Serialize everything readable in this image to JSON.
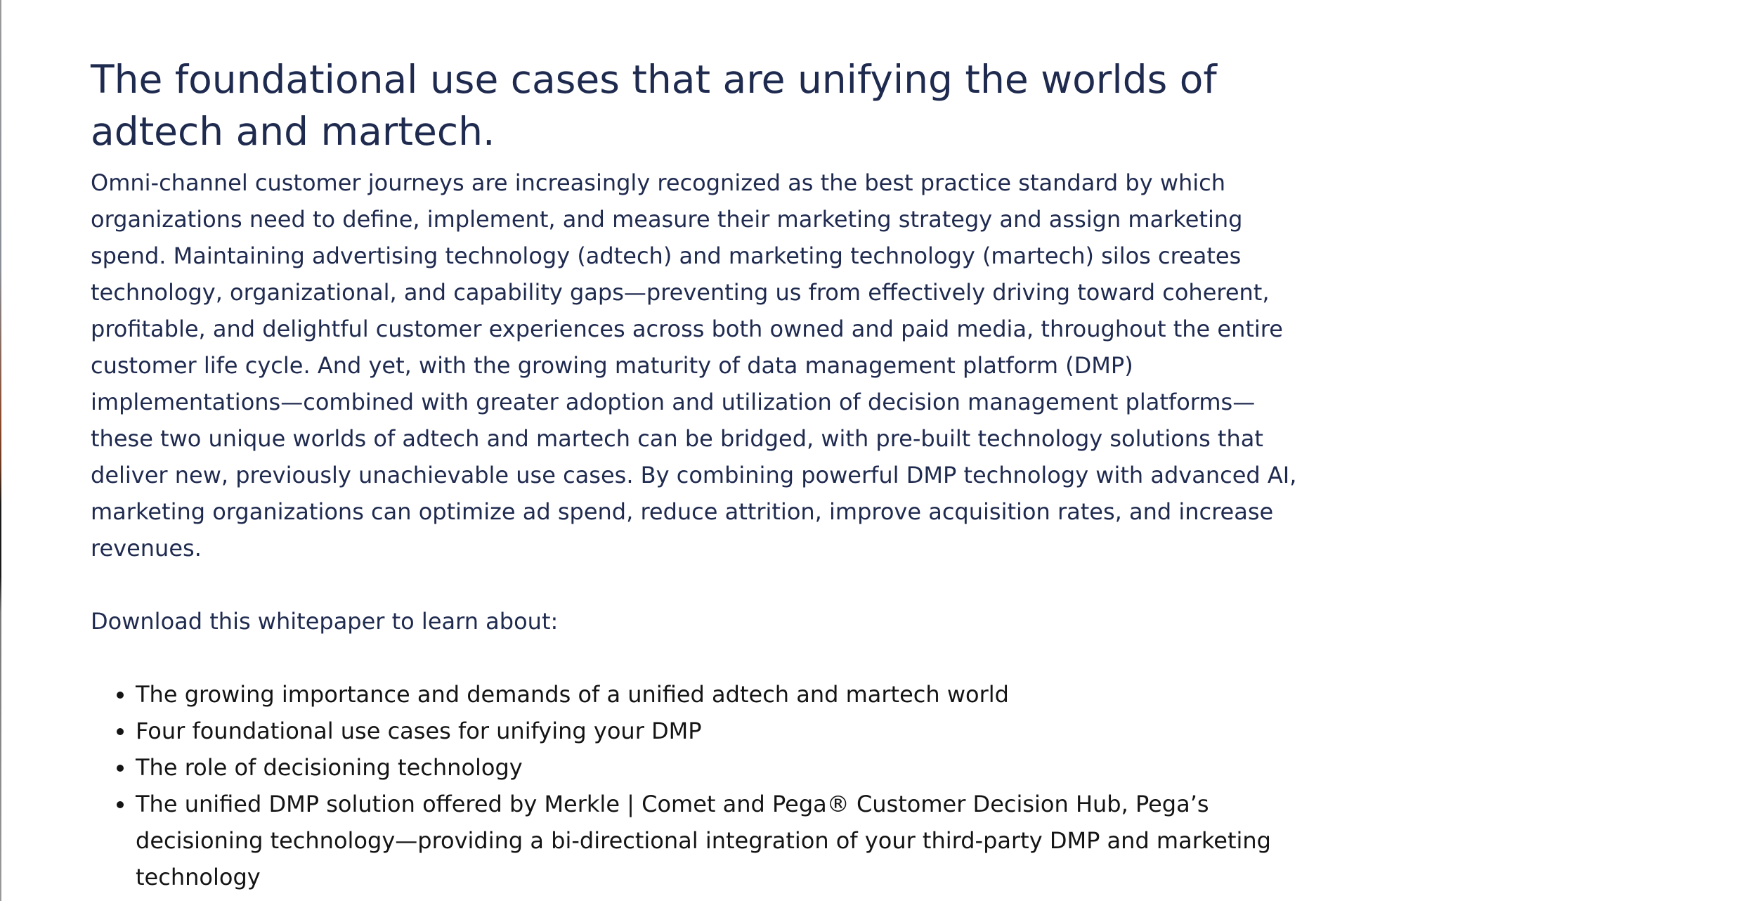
{
  "article": {
    "title": "The foundational use cases that are unifying the worlds of adtech and martech.",
    "intro": "Omni-channel customer journeys are increasingly recognized as the best practice standard by which organizations need to define, implement, and measure their marketing strategy and assign marketing spend. Maintaining advertising technology (adtech) and marketing technology (martech) silos creates technology, organizational, and capability gaps—preventing us from effectively driving toward coherent, profitable, and delightful customer experiences across both owned and paid media, throughout the entire customer life cycle. And yet, with the growing maturity of data management platform (DMP) implementations—combined with greater adoption and utilization of decision management platforms—these two unique worlds of adtech and martech can be bridged, with pre-built technology solutions that deliver new, previously unachievable use cases. By combining powerful DMP technology with advanced AI, marketing organizations can optimize ad spend, reduce attrition, improve acquisition rates, and increase revenues.",
    "download_lead": "Download this whitepaper to learn about:",
    "bullets": [
      "The growing importance and demands of a unified adtech and martech world",
      "Four foundational use cases for unifying your DMP",
      "The role of decisioning technology",
      "The unified DMP solution offered by Merkle | Comet and Pega® Customer Decision Hub, Pega’s decisioning technology—providing a bi-directional integration of your third-party DMP and marketing technology"
    ]
  },
  "colors": {
    "heading": "#1f2a4f",
    "body": "#1f2a4f",
    "list": "#141414",
    "divider": "#eaeaea",
    "background": "#ffffff"
  }
}
